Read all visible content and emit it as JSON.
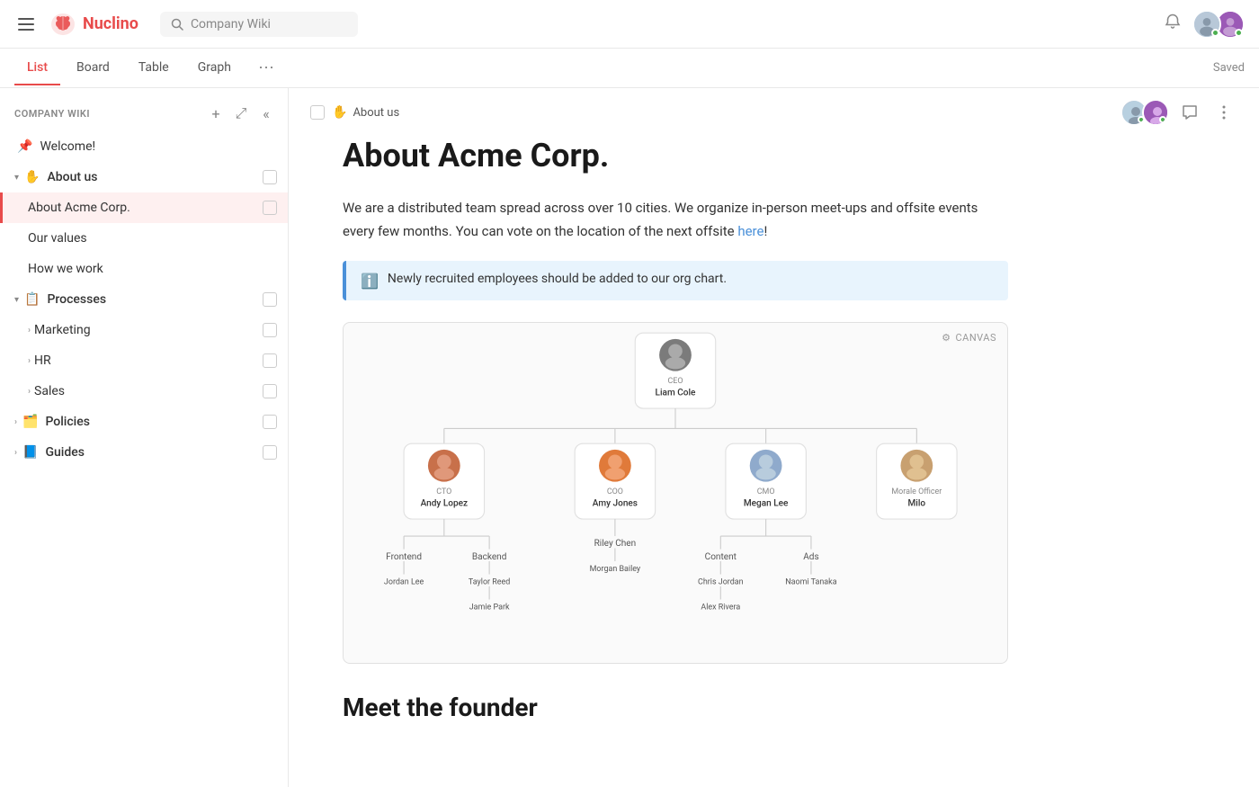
{
  "app": {
    "name": "Nuclino",
    "search_placeholder": "Company Wiki"
  },
  "tabs": [
    {
      "id": "list",
      "label": "List",
      "active": true
    },
    {
      "id": "board",
      "label": "Board",
      "active": false
    },
    {
      "id": "table",
      "label": "Table",
      "active": false
    },
    {
      "id": "graph",
      "label": "Graph",
      "active": false
    }
  ],
  "top_right": {
    "saved_label": "Saved"
  },
  "sidebar": {
    "section_title": "COMPANY WIKI",
    "items": [
      {
        "id": "welcome",
        "label": "Welcome!",
        "icon": "📌",
        "level": 0,
        "pinned": true
      },
      {
        "id": "about-us",
        "label": "About us",
        "icon": "✋",
        "level": 0,
        "expanded": true,
        "is_section": true
      },
      {
        "id": "about-acme",
        "label": "About Acme Corp.",
        "level": 1,
        "active": true
      },
      {
        "id": "our-values",
        "label": "Our values",
        "level": 1
      },
      {
        "id": "how-we-work",
        "label": "How we work",
        "level": 1
      },
      {
        "id": "processes",
        "label": "Processes",
        "icon": "📋",
        "level": 0,
        "expanded": true,
        "is_section": true
      },
      {
        "id": "marketing",
        "label": "Marketing",
        "level": 1,
        "has_chevron": true
      },
      {
        "id": "hr",
        "label": "HR",
        "level": 1,
        "has_chevron": true
      },
      {
        "id": "sales",
        "label": "Sales",
        "level": 1,
        "has_chevron": true
      },
      {
        "id": "policies",
        "label": "Policies",
        "icon": "🗂️",
        "level": 0,
        "is_section": true,
        "collapsed": true
      },
      {
        "id": "guides",
        "label": "Guides",
        "icon": "📘",
        "level": 0,
        "is_section": true,
        "collapsed": true
      }
    ]
  },
  "content": {
    "breadcrumb": {
      "emoji": "✋",
      "label": "About us"
    },
    "page_title": "About Acme Corp.",
    "body_text_1": "We are a distributed team spread across over 10 cities. We organize in-person meet-ups and offsite events every few months. You can vote on the location of the next offsite",
    "link_text": "here",
    "body_text_2": "!",
    "info_box_text": "Newly recruited employees should be added to our org chart.",
    "canvas_label": "CANVAS",
    "org_chart": {
      "ceo": {
        "role": "CEO",
        "name": "Liam Cole",
        "color": "#7b7b7b"
      },
      "cto": {
        "role": "CTO",
        "name": "Andy Lopez",
        "color": "#c8704a"
      },
      "coo": {
        "role": "COO",
        "name": "Amy Jones",
        "color": "#e07a3a"
      },
      "cmo": {
        "role": "CMO",
        "name": "Megan Lee",
        "color": "#8faacc"
      },
      "morale": {
        "role": "Morale Officer",
        "name": "Milo",
        "color": "#c8a070"
      },
      "frontend": {
        "name": "Frontend"
      },
      "backend": {
        "name": "Backend"
      },
      "riley": {
        "name": "Riley Chen"
      },
      "content": {
        "name": "Content"
      },
      "ads": {
        "name": "Ads"
      },
      "jordan": {
        "name": "Jordan Lee"
      },
      "taylor": {
        "name": "Taylor Reed"
      },
      "morgan": {
        "name": "Morgan Bailey"
      },
      "chris": {
        "name": "Chris Jordan"
      },
      "naomi": {
        "name": "Naomi Tanaka"
      },
      "jamie": {
        "name": "Jamie Park"
      },
      "alex": {
        "name": "Alex Rivera"
      }
    },
    "section2_title": "Meet the founder"
  }
}
